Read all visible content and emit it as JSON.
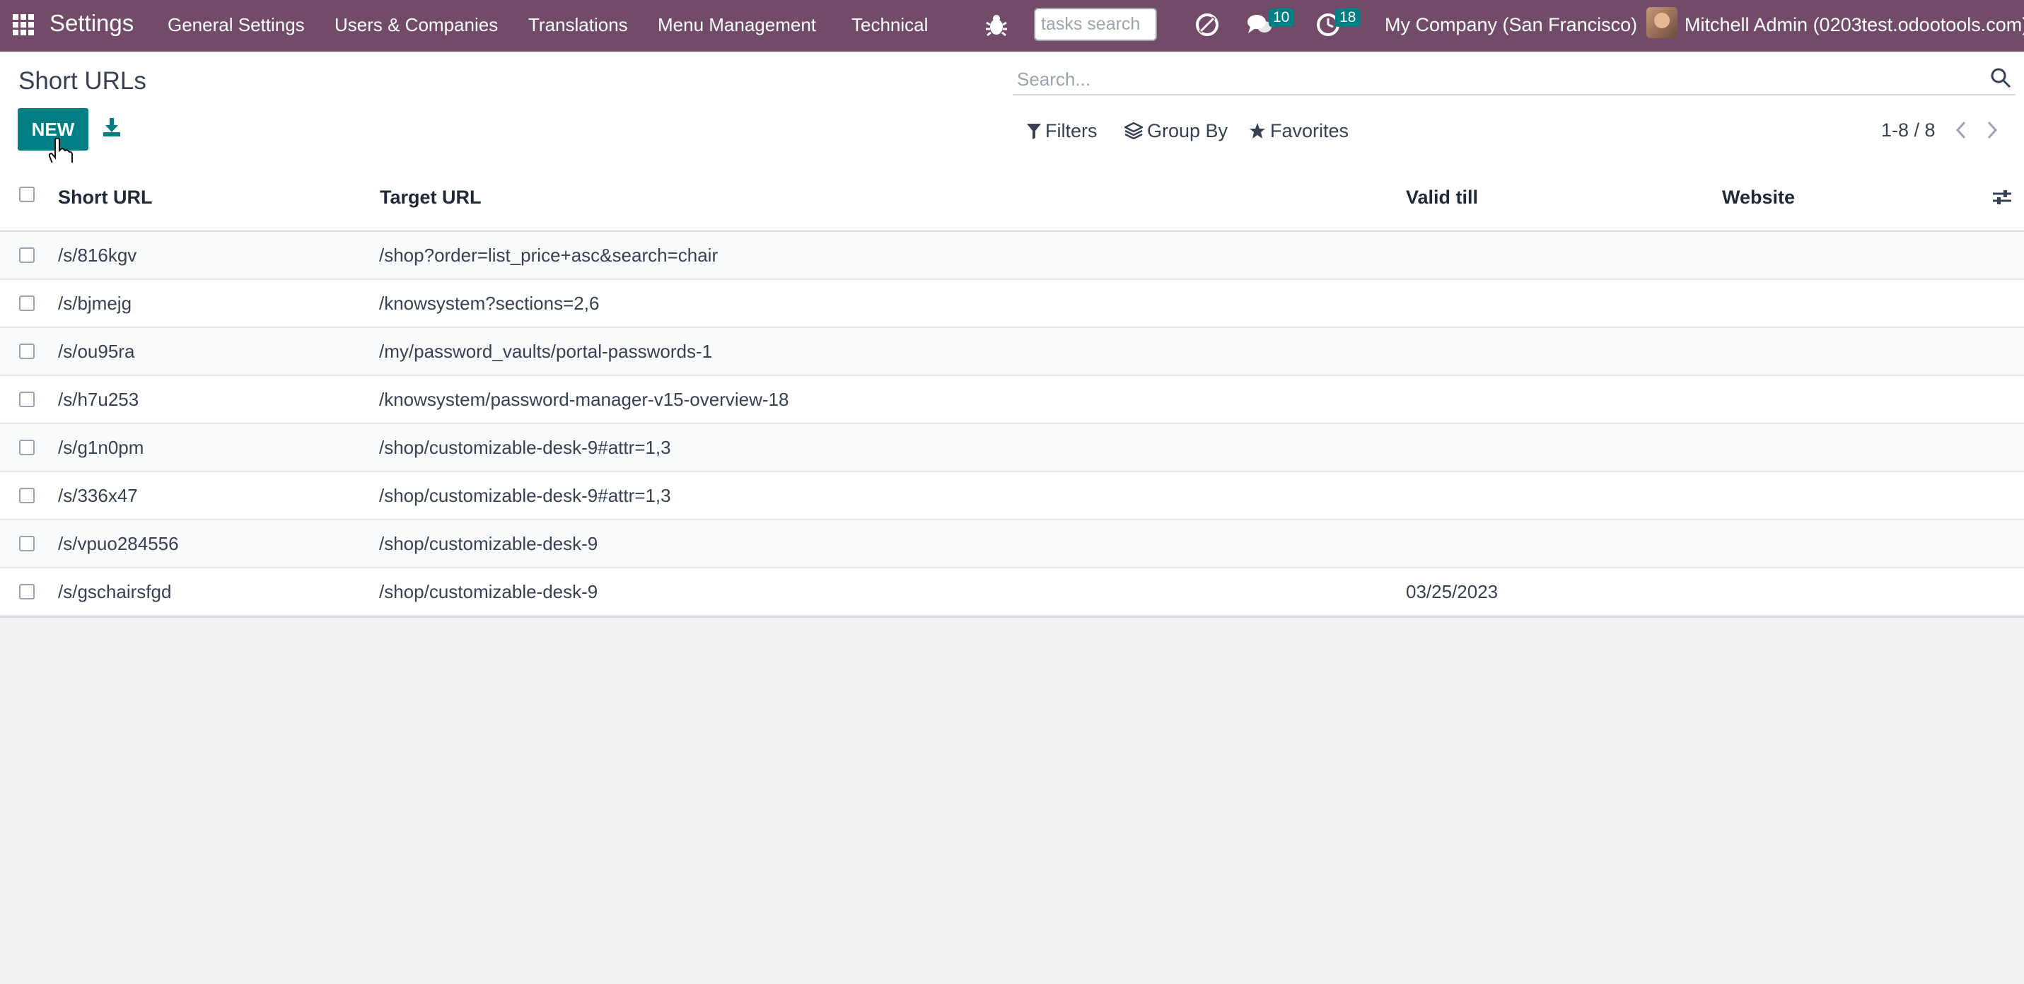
{
  "navbar": {
    "app_title": "Settings",
    "menu": [
      "General Settings",
      "Users & Companies",
      "Translations",
      "Menu Management",
      "Technical"
    ],
    "tasks_search_placeholder": "tasks search",
    "messages_count": "10",
    "activities_count": "18",
    "company": "My Company (San Francisco)",
    "user": "Mitchell Admin (0203test.odootools.com)"
  },
  "control": {
    "title": "Short URLs",
    "new_label": "NEW",
    "search_placeholder": "Search...",
    "filters_label": "Filters",
    "groupby_label": "Group By",
    "favorites_label": "Favorites",
    "pager": "1-8 / 8"
  },
  "table": {
    "columns": [
      "Short URL",
      "Target URL",
      "Valid till",
      "Website"
    ],
    "rows": [
      {
        "short_url": "/s/816kgv",
        "target_url": "/shop?order=list_price+asc&search=chair",
        "valid_till": "",
        "website": ""
      },
      {
        "short_url": "/s/bjmejg",
        "target_url": "/knowsystem?sections=2,6",
        "valid_till": "",
        "website": ""
      },
      {
        "short_url": "/s/ou95ra",
        "target_url": "/my/password_vaults/portal-passwords-1",
        "valid_till": "",
        "website": ""
      },
      {
        "short_url": "/s/h7u253",
        "target_url": "/knowsystem/password-manager-v15-overview-18",
        "valid_till": "",
        "website": ""
      },
      {
        "short_url": "/s/g1n0pm",
        "target_url": "/shop/customizable-desk-9#attr=1,3",
        "valid_till": "",
        "website": ""
      },
      {
        "short_url": "/s/336x47",
        "target_url": "/shop/customizable-desk-9#attr=1,3",
        "valid_till": "",
        "website": ""
      },
      {
        "short_url": "/s/vpuo284556",
        "target_url": "/shop/customizable-desk-9",
        "valid_till": "",
        "website": ""
      },
      {
        "short_url": "/s/gschairsfgd",
        "target_url": "/shop/customizable-desk-9",
        "valid_till": "03/25/2023",
        "website": ""
      }
    ]
  }
}
